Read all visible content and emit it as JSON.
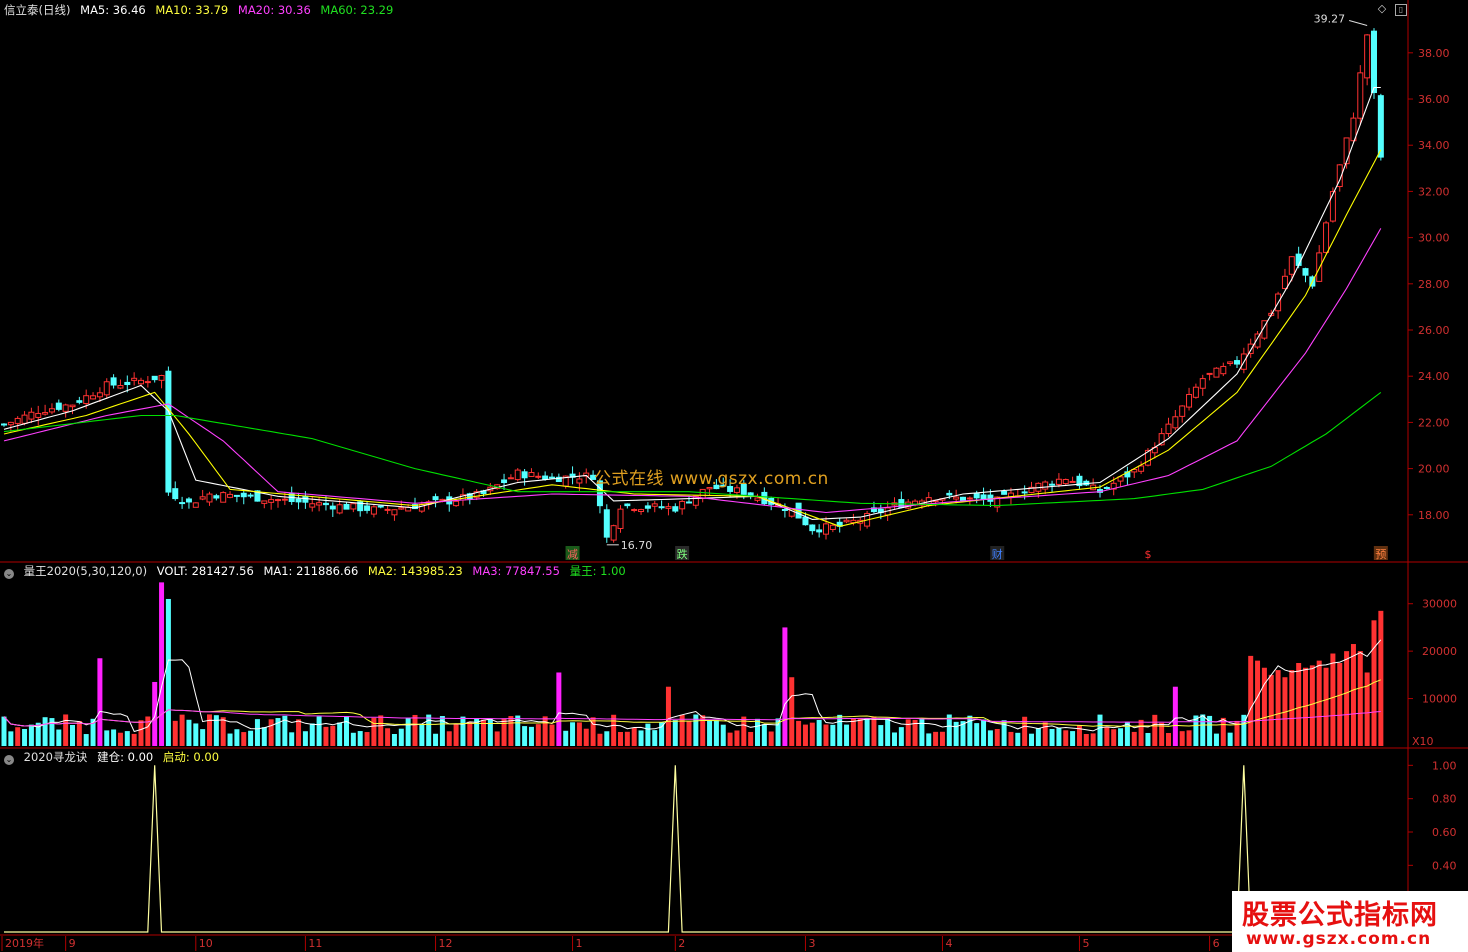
{
  "main_header": {
    "title": "信立泰(日线)",
    "ma5": "MA5: 36.46",
    "ma10": "MA10: 33.79",
    "ma20": "MA20: 30.36",
    "ma60": "MA60: 23.29"
  },
  "vol_header": {
    "name": "量王2020(5,30,120,0)",
    "volt": "VOLT: 281427.56",
    "ma1": "MA1: 211886.66",
    "ma2": "MA2: 143985.23",
    "ma3": "MA3: 77847.55",
    "lw": "量王: 1.00"
  },
  "ind_header": {
    "name": "2020寻龙诀",
    "jc": "建仓: 0.00",
    "qd": "启动: 0.00"
  },
  "annotations": {
    "high": "39.27",
    "low": "16.70",
    "x10": "X10",
    "watermark": "公式在线 www.gszx.com.cn",
    "logo_line1": "股票公式指标网",
    "logo_line2": "www.gszx.com.cn"
  },
  "event_markers": [
    {
      "label": "减",
      "color": "#ff6060",
      "bg": "#1a5a1a"
    },
    {
      "label": "跌",
      "color": "#80ff80",
      "bg": "#2a2a2a"
    },
    {
      "label": "财",
      "color": "#4080ff",
      "bg": "#222"
    },
    {
      "label": "$",
      "color": "#ff3030",
      "bg": "#000"
    },
    {
      "label": "预",
      "color": "#ff8040",
      "bg": "#603010"
    }
  ],
  "time_axis": [
    "2019年",
    "9",
    "10",
    "11",
    "12",
    "1",
    "2",
    "3",
    "4",
    "5",
    "6"
  ],
  "colors": {
    "up": "#ff3232",
    "down": "#54ffff",
    "ma5": "#ffffff",
    "ma10": "#ffff00",
    "ma20": "#ff40ff",
    "ma60": "#00e000",
    "axis": "#b00000",
    "vol_magenta": "#ff20ff"
  },
  "chart_data": [
    {
      "type": "candlestick",
      "title": "信立泰(日线)",
      "y_ticks": [
        18.0,
        20.0,
        22.0,
        24.0,
        26.0,
        28.0,
        30.0,
        32.0,
        34.0,
        36.0,
        38.0
      ],
      "ylim": [
        16.0,
        40.2
      ],
      "high_label": 39.27,
      "low_label": 16.7,
      "close_path": [
        [
          0,
          21.9
        ],
        [
          5,
          22.5
        ],
        [
          10,
          22.8
        ],
        [
          15,
          23.6
        ],
        [
          20,
          23.8
        ],
        [
          23,
          24.0
        ],
        [
          24,
          19.0
        ],
        [
          27,
          18.5
        ],
        [
          30,
          18.9
        ],
        [
          35,
          18.8
        ],
        [
          45,
          18.5
        ],
        [
          55,
          18.2
        ],
        [
          65,
          18.6
        ],
        [
          70,
          18.9
        ],
        [
          75,
          19.8
        ],
        [
          80,
          19.6
        ],
        [
          86,
          19.7
        ],
        [
          88,
          17.0
        ],
        [
          90,
          18.4
        ],
        [
          98,
          18.3
        ],
        [
          103,
          19.2
        ],
        [
          108,
          19.0
        ],
        [
          115,
          18.2
        ],
        [
          118,
          17.4
        ],
        [
          122,
          17.5
        ],
        [
          126,
          17.9
        ],
        [
          130,
          18.4
        ],
        [
          135,
          18.8
        ],
        [
          145,
          18.6
        ],
        [
          150,
          19.2
        ],
        [
          155,
          19.6
        ],
        [
          160,
          19.0
        ],
        [
          165,
          19.9
        ],
        [
          170,
          21.8
        ],
        [
          175,
          23.9
        ],
        [
          180,
          24.6
        ],
        [
          185,
          26.8
        ],
        [
          188,
          29.1
        ],
        [
          191,
          28.0
        ],
        [
          194,
          32.0
        ],
        [
          197,
          35.3
        ],
        [
          199,
          38.8
        ],
        [
          201,
          33.5
        ]
      ],
      "ma_lines": [
        {
          "name": "MA5",
          "path": [
            [
              0,
              21.7
            ],
            [
              10,
              22.5
            ],
            [
              20,
              23.6
            ],
            [
              24,
              22.5
            ],
            [
              28,
              19.5
            ],
            [
              40,
              18.8
            ],
            [
              60,
              18.3
            ],
            [
              75,
              19.4
            ],
            [
              85,
              19.7
            ],
            [
              89,
              18.6
            ],
            [
              100,
              18.7
            ],
            [
              110,
              18.8
            ],
            [
              118,
              17.8
            ],
            [
              125,
              17.9
            ],
            [
              140,
              18.9
            ],
            [
              160,
              19.4
            ],
            [
              170,
              21.3
            ],
            [
              180,
              24.1
            ],
            [
              188,
              28.2
            ],
            [
              195,
              32.5
            ],
            [
              200,
              36.5
            ]
          ]
        },
        {
          "name": "MA10",
          "path": [
            [
              0,
              21.5
            ],
            [
              12,
              22.3
            ],
            [
              22,
              23.3
            ],
            [
              27,
              21.5
            ],
            [
              33,
              19.1
            ],
            [
              60,
              18.4
            ],
            [
              80,
              19.3
            ],
            [
              92,
              18.9
            ],
            [
              110,
              18.8
            ],
            [
              122,
              17.5
            ],
            [
              135,
              18.4
            ],
            [
              160,
              19.2
            ],
            [
              170,
              20.8
            ],
            [
              180,
              23.3
            ],
            [
              190,
              27.5
            ],
            [
              196,
              31.0
            ],
            [
              201,
              33.8
            ]
          ]
        },
        {
          "name": "MA20",
          "path": [
            [
              0,
              21.2
            ],
            [
              15,
              22.3
            ],
            [
              24,
              22.8
            ],
            [
              32,
              21.2
            ],
            [
              40,
              19.0
            ],
            [
              60,
              18.5
            ],
            [
              80,
              18.9
            ],
            [
              100,
              18.8
            ],
            [
              120,
              18.1
            ],
            [
              140,
              18.6
            ],
            [
              160,
              19.0
            ],
            [
              170,
              19.7
            ],
            [
              180,
              21.2
            ],
            [
              190,
              25.0
            ],
            [
              196,
              27.8
            ],
            [
              201,
              30.4
            ]
          ]
        },
        {
          "name": "MA60",
          "path": [
            [
              0,
              21.6
            ],
            [
              20,
              22.3
            ],
            [
              25,
              22.3
            ],
            [
              45,
              21.3
            ],
            [
              60,
              20.0
            ],
            [
              75,
              19.0
            ],
            [
              100,
              19.0
            ],
            [
              125,
              18.5
            ],
            [
              145,
              18.4
            ],
            [
              165,
              18.7
            ],
            [
              175,
              19.1
            ],
            [
              185,
              20.1
            ],
            [
              193,
              21.5
            ],
            [
              201,
              23.3
            ]
          ]
        }
      ]
    },
    {
      "type": "bar",
      "title": "量王2020(5,30,120,0)",
      "y_ticks": [
        10000,
        20000,
        30000
      ],
      "ylim": [
        0,
        35000
      ],
      "unit": "X10",
      "spikes": [
        {
          "i": 14,
          "v": 18500,
          "c": "magenta"
        },
        {
          "i": 22,
          "v": 13500,
          "c": "magenta"
        },
        {
          "i": 23,
          "v": 34500,
          "c": "magenta"
        },
        {
          "i": 24,
          "v": 31000,
          "c": "cyan"
        },
        {
          "i": 81,
          "v": 15500,
          "c": "magenta"
        },
        {
          "i": 97,
          "v": 12500,
          "c": "red"
        },
        {
          "i": 114,
          "v": 25000,
          "c": "magenta"
        },
        {
          "i": 115,
          "v": 14500,
          "c": "red"
        },
        {
          "i": 171,
          "v": 12500,
          "c": "magenta"
        }
      ],
      "red_block": {
        "from": 182,
        "to": 201,
        "values": [
          19000,
          18000,
          16500,
          15000,
          16000,
          14500,
          16000,
          17500,
          16500,
          17000,
          18000,
          16500,
          19500,
          17500,
          20000,
          21500,
          20000,
          15500,
          26500,
          28500
        ]
      }
    },
    {
      "type": "line",
      "title": "2020寻龙诀",
      "y_ticks": [
        0.4,
        0.6,
        0.8,
        1.0
      ],
      "ylim": [
        0,
        1.08
      ],
      "peaks_at": [
        22,
        98,
        181
      ],
      "peak_value": 1.0
    }
  ]
}
